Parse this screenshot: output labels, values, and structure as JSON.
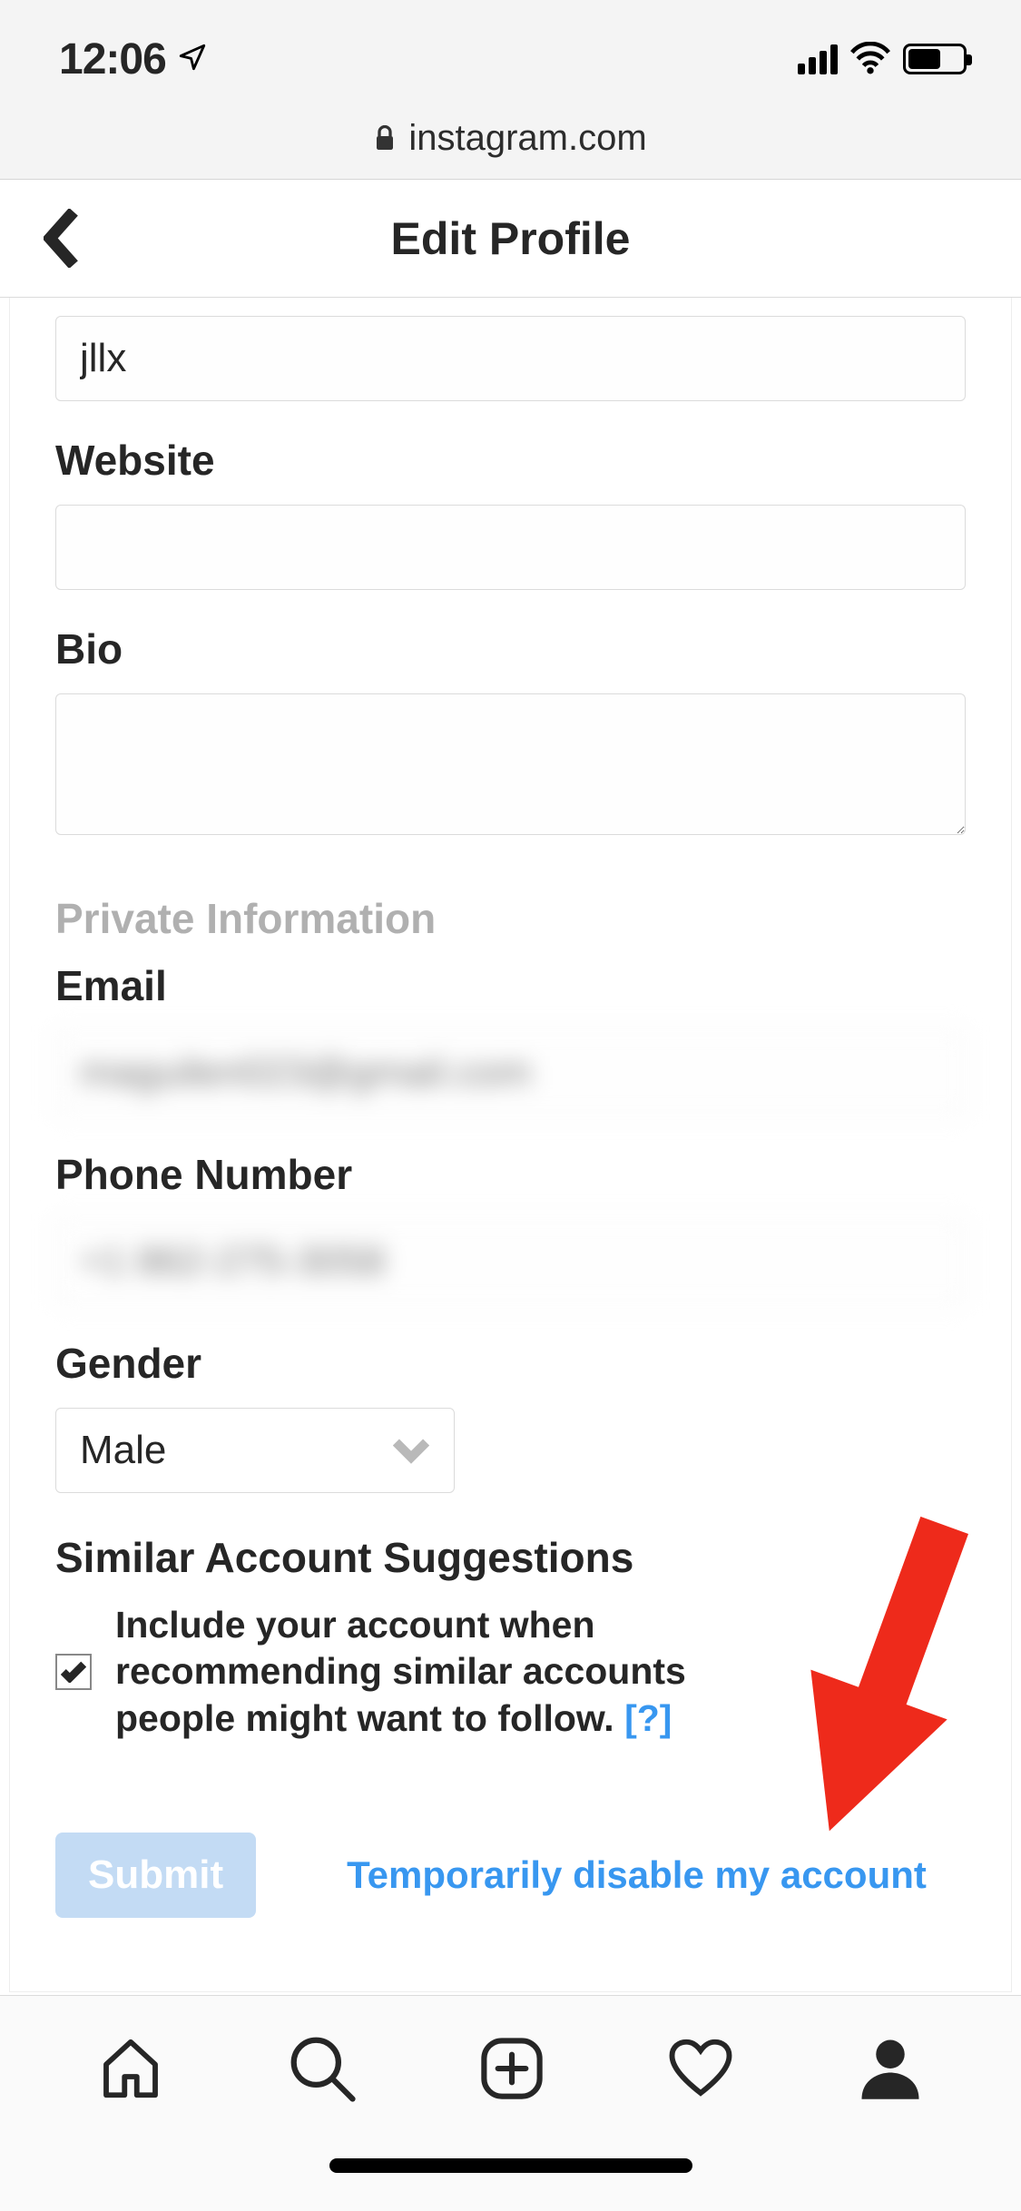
{
  "statusbar": {
    "time": "12:06"
  },
  "urlbar": {
    "domain": "instagram.com"
  },
  "nav": {
    "title": "Edit Profile"
  },
  "form": {
    "username_value": "jllx",
    "website_label": "Website",
    "website_value": "",
    "bio_label": "Bio",
    "bio_value": "",
    "private_heading": "Private Information",
    "email_label": "Email",
    "email_value": "maguilen023@gmail.com",
    "phone_label": "Phone Number",
    "phone_value": "+1 862-275-3058",
    "gender_label": "Gender",
    "gender_value": "Male",
    "similar_heading": "Similar Account Suggestions",
    "similar_text": "Include your account when recommending similar accounts people might want to follow.  ",
    "help_link": "[?]",
    "submit_label": "Submit",
    "disable_link": "Temporarily disable my account"
  }
}
